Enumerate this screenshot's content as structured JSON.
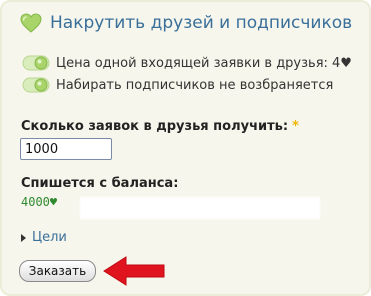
{
  "header": {
    "title": "Накрутить друзей и подписчиков",
    "icon": "heart-icon",
    "icon_color": "#9fcf5e"
  },
  "info": [
    {
      "icon": "toggle-icon",
      "text": "Цена одной входящей заявки в друзья: 4♥"
    },
    {
      "icon": "toggle-icon",
      "text": "Набирать подписчиков не возбраняется"
    }
  ],
  "form": {
    "quantity_label": "Сколько заявок в друзья получить:",
    "required_mark": "*",
    "quantity_value": "1000",
    "balance_label": "Спишется с баланса:",
    "balance_value": "4000♥",
    "balance_color": "#2f8a2f"
  },
  "goals": {
    "label": "Цели"
  },
  "actions": {
    "order_label": "Заказать",
    "arrow_color": "#e0141e"
  }
}
